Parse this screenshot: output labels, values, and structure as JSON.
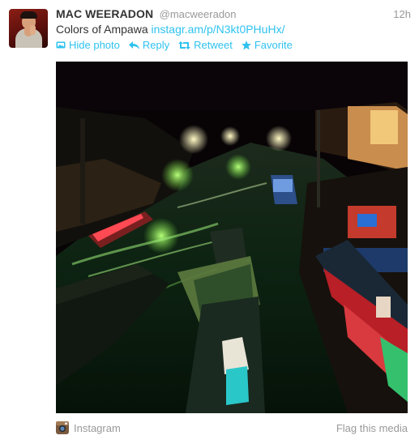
{
  "tweet": {
    "author_name": "MAC WEERADON",
    "author_handle": "@macweeradon",
    "time": "12h",
    "text": "Colors of Ampawa",
    "link": "instagr.am/p/N3kt0PHuHx/"
  },
  "actions": {
    "hide_photo": "Hide photo",
    "reply": "Reply",
    "retweet": "Retweet",
    "favorite": "Favorite"
  },
  "footer": {
    "source": "Instagram",
    "flag": "Flag this media"
  },
  "colors": {
    "link": "#2fc2ef",
    "name": "#333333",
    "muted": "#999999"
  },
  "icons": [
    "avatar",
    "photo-icon",
    "reply-icon",
    "retweet-icon",
    "star-icon",
    "instagram-icon"
  ]
}
